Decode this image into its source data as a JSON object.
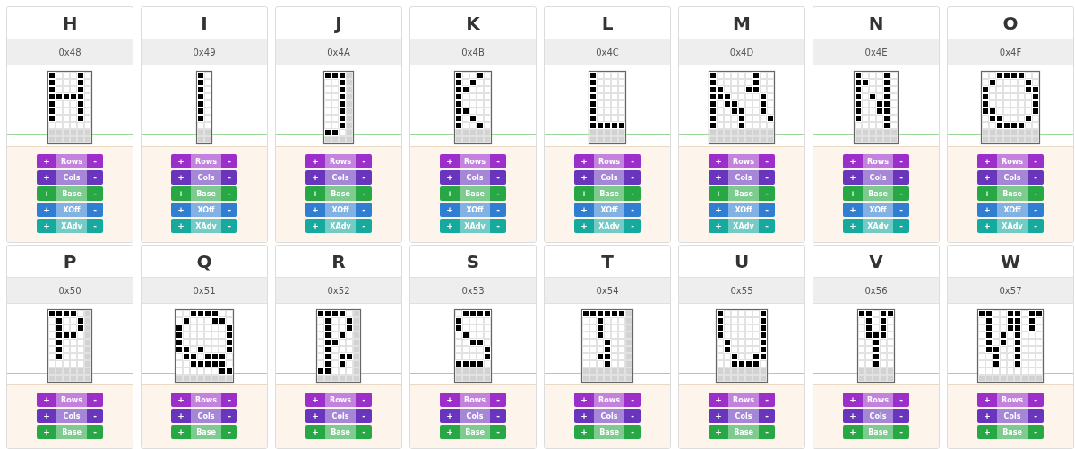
{
  "glyphs": [
    {
      "letter": "H",
      "code": "0x48",
      "pixels": [
        [
          true,
          false,
          false,
          false,
          true,
          false
        ],
        [
          true,
          false,
          false,
          false,
          true,
          false
        ],
        [
          true,
          false,
          false,
          false,
          true,
          false
        ],
        [
          true,
          true,
          true,
          true,
          true,
          false
        ],
        [
          true,
          false,
          false,
          false,
          true,
          false
        ],
        [
          true,
          false,
          false,
          false,
          true,
          false
        ],
        [
          true,
          false,
          false,
          false,
          true,
          false
        ],
        [
          false,
          false,
          false,
          false,
          false,
          false
        ]
      ],
      "margin_rows": [
        [
          false,
          false,
          false,
          false,
          false,
          false
        ],
        [
          false,
          false,
          false,
          false,
          false,
          false
        ]
      ],
      "controls": [
        {
          "label": "Rows",
          "plus": "+",
          "minus": "-",
          "color": "#9c2fc9"
        },
        {
          "label": "Cols",
          "plus": "+",
          "minus": "-",
          "color": "#6a35bd"
        },
        {
          "label": "Base",
          "plus": "+",
          "minus": "-",
          "color": "#27a844"
        },
        {
          "label": "XOff",
          "plus": "+",
          "minus": "-",
          "color": "#2f7ed1"
        },
        {
          "label": "XAdv",
          "plus": "+",
          "minus": "-",
          "color": "#16a99e"
        }
      ]
    },
    {
      "letter": "I",
      "code": "0x49",
      "pixels": [
        [
          true,
          false
        ],
        [
          true,
          false
        ],
        [
          true,
          false
        ],
        [
          true,
          false
        ],
        [
          true,
          false
        ],
        [
          true,
          false
        ],
        [
          true,
          false
        ],
        [
          false,
          false
        ]
      ],
      "margin_rows": [
        [
          false,
          false
        ],
        [
          false,
          false
        ]
      ],
      "controls": [
        {
          "label": "Rows",
          "plus": "+",
          "minus": "-",
          "color": "#9c2fc9"
        },
        {
          "label": "Cols",
          "plus": "+",
          "minus": "-",
          "color": "#6a35bd"
        },
        {
          "label": "Base",
          "plus": "+",
          "minus": "-",
          "color": "#27a844"
        },
        {
          "label": "XOff",
          "plus": "+",
          "minus": "-",
          "color": "#2f7ed1"
        },
        {
          "label": "XAdv",
          "plus": "+",
          "minus": "-",
          "color": "#16a99e"
        }
      ]
    },
    {
      "letter": "J",
      "code": "0x4A",
      "pixels": [
        [
          true,
          true,
          true
        ],
        [
          false,
          false,
          true
        ],
        [
          false,
          false,
          true
        ],
        [
          false,
          false,
          true
        ],
        [
          false,
          false,
          true
        ],
        [
          false,
          false,
          true
        ],
        [
          false,
          false,
          true
        ],
        [
          false,
          false,
          true
        ],
        [
          true,
          true,
          false
        ]
      ],
      "margin_column": true,
      "margin_rows": [
        [
          false,
          false,
          false,
          false
        ]
      ],
      "controls": [
        {
          "label": "Rows",
          "plus": "+",
          "minus": "-",
          "color": "#9c2fc9"
        },
        {
          "label": "Cols",
          "plus": "+",
          "minus": "-",
          "color": "#6a35bd"
        },
        {
          "label": "Base",
          "plus": "+",
          "minus": "-",
          "color": "#27a844"
        },
        {
          "label": "XOff",
          "plus": "+",
          "minus": "-",
          "color": "#2f7ed1"
        },
        {
          "label": "XAdv",
          "plus": "+",
          "minus": "-",
          "color": "#16a99e"
        }
      ]
    },
    {
      "letter": "K",
      "code": "0x4B",
      "pixels": [
        [
          true,
          false,
          false,
          true,
          false
        ],
        [
          true,
          false,
          true,
          false,
          false
        ],
        [
          true,
          true,
          false,
          false,
          false
        ],
        [
          true,
          false,
          false,
          false,
          false
        ],
        [
          true,
          false,
          false,
          false,
          false
        ],
        [
          true,
          true,
          false,
          false,
          false
        ],
        [
          true,
          false,
          true,
          false,
          false
        ],
        [
          true,
          false,
          false,
          true,
          false
        ]
      ],
      "margin_rows": [
        [
          false,
          false,
          false,
          false,
          false
        ],
        [
          false,
          false,
          false,
          false,
          false
        ]
      ],
      "controls": [
        {
          "label": "Rows",
          "plus": "+",
          "minus": "-",
          "color": "#9c2fc9"
        },
        {
          "label": "Cols",
          "plus": "+",
          "minus": "-",
          "color": "#6a35bd"
        },
        {
          "label": "Base",
          "plus": "+",
          "minus": "-",
          "color": "#27a844"
        },
        {
          "label": "XOff",
          "plus": "+",
          "minus": "-",
          "color": "#2f7ed1"
        },
        {
          "label": "XAdv",
          "plus": "+",
          "minus": "-",
          "color": "#16a99e"
        }
      ]
    },
    {
      "letter": "L",
      "code": "0x4C",
      "pixels": [
        [
          true,
          false,
          false,
          false,
          false
        ],
        [
          true,
          false,
          false,
          false,
          false
        ],
        [
          true,
          false,
          false,
          false,
          false
        ],
        [
          true,
          false,
          false,
          false,
          false
        ],
        [
          true,
          false,
          false,
          false,
          false
        ],
        [
          true,
          false,
          false,
          false,
          false
        ],
        [
          true,
          false,
          false,
          false,
          false
        ],
        [
          true,
          true,
          true,
          true,
          true
        ]
      ],
      "margin_rows": [
        [
          false,
          false,
          false,
          false,
          false
        ],
        [
          false,
          false,
          false,
          false,
          false
        ]
      ],
      "controls": [
        {
          "label": "Rows",
          "plus": "+",
          "minus": "-",
          "color": "#9c2fc9"
        },
        {
          "label": "Cols",
          "plus": "+",
          "minus": "-",
          "color": "#6a35bd"
        },
        {
          "label": "Base",
          "plus": "+",
          "minus": "-",
          "color": "#27a844"
        },
        {
          "label": "XOff",
          "plus": "+",
          "minus": "-",
          "color": "#2f7ed1"
        },
        {
          "label": "XAdv",
          "plus": "+",
          "minus": "-",
          "color": "#16a99e"
        }
      ]
    },
    {
      "letter": "M",
      "code": "0x4D",
      "pixels": [
        [
          true,
          false,
          false,
          false,
          false,
          false,
          true,
          false,
          false
        ],
        [
          true,
          false,
          false,
          false,
          false,
          false,
          true,
          false,
          false
        ],
        [
          true,
          true,
          false,
          false,
          false,
          true,
          true,
          false,
          false
        ],
        [
          true,
          true,
          true,
          false,
          false,
          false,
          false,
          true,
          false
        ],
        [
          true,
          false,
          true,
          true,
          false,
          false,
          false,
          true,
          false
        ],
        [
          true,
          false,
          false,
          true,
          true,
          false,
          false,
          true,
          false
        ],
        [
          true,
          false,
          false,
          false,
          true,
          false,
          false,
          false,
          true
        ],
        [
          true,
          false,
          false,
          false,
          true,
          false,
          false,
          false,
          false
        ]
      ],
      "margin_rows": [
        [
          false,
          false,
          false,
          false,
          false,
          false,
          false,
          false,
          false
        ],
        [
          false,
          false,
          false,
          false,
          false,
          false,
          false,
          false,
          false
        ]
      ],
      "controls": [
        {
          "label": "Rows",
          "plus": "+",
          "minus": "-",
          "color": "#9c2fc9"
        },
        {
          "label": "Cols",
          "plus": "+",
          "minus": "-",
          "color": "#6a35bd"
        },
        {
          "label": "Base",
          "plus": "+",
          "minus": "-",
          "color": "#27a844"
        },
        {
          "label": "XOff",
          "plus": "+",
          "minus": "-",
          "color": "#2f7ed1"
        },
        {
          "label": "XAdv",
          "plus": "+",
          "minus": "-",
          "color": "#16a99e"
        }
      ]
    },
    {
      "letter": "N",
      "code": "0x4E",
      "pixels": [
        [
          true,
          false,
          false,
          false,
          true,
          false
        ],
        [
          true,
          true,
          false,
          false,
          true,
          false
        ],
        [
          true,
          false,
          false,
          false,
          true,
          false
        ],
        [
          true,
          false,
          true,
          false,
          true,
          false
        ],
        [
          true,
          false,
          false,
          true,
          true,
          false
        ],
        [
          true,
          false,
          false,
          true,
          true,
          false
        ],
        [
          true,
          false,
          false,
          false,
          true,
          false
        ],
        [
          false,
          false,
          false,
          false,
          true,
          false
        ]
      ],
      "margin_rows": [
        [
          false,
          false,
          false,
          false,
          false,
          false
        ],
        [
          false,
          false,
          false,
          false,
          false,
          false
        ]
      ],
      "controls": [
        {
          "label": "Rows",
          "plus": "+",
          "minus": "-",
          "color": "#9c2fc9"
        },
        {
          "label": "Cols",
          "plus": "+",
          "minus": "-",
          "color": "#6a35bd"
        },
        {
          "label": "Base",
          "plus": "+",
          "minus": "-",
          "color": "#27a844"
        },
        {
          "label": "XOff",
          "plus": "+",
          "minus": "-",
          "color": "#2f7ed1"
        },
        {
          "label": "XAdv",
          "plus": "+",
          "minus": "-",
          "color": "#16a99e"
        }
      ]
    },
    {
      "letter": "O",
      "code": "0x4F",
      "pixels": [
        [
          false,
          false,
          true,
          true,
          true,
          true,
          false,
          false
        ],
        [
          false,
          true,
          false,
          false,
          false,
          false,
          true,
          false
        ],
        [
          true,
          false,
          false,
          false,
          false,
          false,
          true,
          true
        ],
        [
          true,
          false,
          false,
          false,
          false,
          false,
          false,
          true
        ],
        [
          true,
          false,
          false,
          false,
          false,
          false,
          false,
          true
        ],
        [
          true,
          true,
          false,
          false,
          false,
          false,
          false,
          true
        ],
        [
          false,
          true,
          true,
          false,
          false,
          false,
          true,
          false
        ],
        [
          false,
          false,
          true,
          true,
          true,
          true,
          false,
          false
        ]
      ],
      "margin_rows": [
        [
          false,
          false,
          false,
          false,
          false,
          false,
          false,
          false
        ],
        [
          false,
          false,
          false,
          false,
          false,
          false,
          false,
          false
        ]
      ],
      "controls": [
        {
          "label": "Rows",
          "plus": "+",
          "minus": "-",
          "color": "#9c2fc9"
        },
        {
          "label": "Cols",
          "plus": "+",
          "minus": "-",
          "color": "#6a35bd"
        },
        {
          "label": "Base",
          "plus": "+",
          "minus": "-",
          "color": "#27a844"
        },
        {
          "label": "XOff",
          "plus": "+",
          "minus": "-",
          "color": "#2f7ed1"
        },
        {
          "label": "XAdv",
          "plus": "+",
          "minus": "-",
          "color": "#16a99e"
        }
      ]
    },
    {
      "letter": "P",
      "code": "0x50",
      "pixels": [
        [
          true,
          true,
          true,
          true,
          false
        ],
        [
          false,
          true,
          false,
          false,
          true
        ],
        [
          false,
          true,
          false,
          false,
          true
        ],
        [
          false,
          true,
          true,
          true,
          false
        ],
        [
          false,
          true,
          false,
          false,
          false
        ],
        [
          false,
          true,
          false,
          false,
          false
        ],
        [
          false,
          true,
          false,
          false,
          false
        ],
        [
          false,
          false,
          false,
          false,
          false
        ]
      ],
      "margin_column": true,
      "margin_rows": [
        [
          false,
          false,
          false,
          false,
          false,
          false
        ],
        [
          false,
          false,
          false,
          false,
          false,
          false
        ]
      ],
      "controls": [
        {
          "label": "Rows",
          "plus": "+",
          "minus": "-",
          "color": "#9c2fc9"
        },
        {
          "label": "Cols",
          "plus": "+",
          "minus": "-",
          "color": "#6a35bd"
        },
        {
          "label": "Base",
          "plus": "+",
          "minus": "-",
          "color": "#27a844"
        }
      ]
    },
    {
      "letter": "Q",
      "code": "0x51",
      "pixels": [
        [
          false,
          false,
          true,
          true,
          true,
          true,
          false,
          false
        ],
        [
          false,
          true,
          false,
          false,
          false,
          true,
          true,
          false
        ],
        [
          true,
          false,
          false,
          false,
          false,
          false,
          false,
          true
        ],
        [
          true,
          false,
          false,
          false,
          false,
          false,
          false,
          true
        ],
        [
          true,
          false,
          false,
          false,
          false,
          false,
          false,
          true
        ],
        [
          true,
          true,
          false,
          true,
          false,
          false,
          false,
          true
        ],
        [
          false,
          true,
          true,
          false,
          true,
          true,
          true,
          false
        ],
        [
          false,
          false,
          true,
          true,
          true,
          true,
          true,
          false
        ],
        [
          false,
          false,
          false,
          false,
          false,
          false,
          true,
          true
        ]
      ],
      "margin_rows": [
        [
          false,
          false,
          false,
          false,
          false,
          false,
          false,
          false
        ]
      ],
      "controls": [
        {
          "label": "Rows",
          "plus": "+",
          "minus": "-",
          "color": "#9c2fc9"
        },
        {
          "label": "Cols",
          "plus": "+",
          "minus": "-",
          "color": "#6a35bd"
        },
        {
          "label": "Base",
          "plus": "+",
          "minus": "-",
          "color": "#27a844"
        }
      ]
    },
    {
      "letter": "R",
      "code": "0x52",
      "pixels": [
        [
          true,
          true,
          true,
          true,
          false
        ],
        [
          false,
          true,
          false,
          false,
          true
        ],
        [
          false,
          true,
          false,
          false,
          true
        ],
        [
          false,
          true,
          false,
          true,
          false
        ],
        [
          false,
          true,
          true,
          false,
          false
        ],
        [
          false,
          true,
          false,
          false,
          false
        ],
        [
          false,
          true,
          false,
          true,
          true
        ],
        [
          false,
          true,
          false,
          true,
          false
        ],
        [
          true,
          true,
          false,
          false,
          false
        ]
      ],
      "margin_column": true,
      "margin_rows": [
        [
          false,
          false,
          false,
          false,
          false,
          false
        ]
      ],
      "controls": [
        {
          "label": "Rows",
          "plus": "+",
          "minus": "-",
          "color": "#9c2fc9"
        },
        {
          "label": "Cols",
          "plus": "+",
          "minus": "-",
          "color": "#6a35bd"
        },
        {
          "label": "Base",
          "plus": "+",
          "minus": "-",
          "color": "#27a844"
        }
      ]
    },
    {
      "letter": "S",
      "code": "0x53",
      "pixels": [
        [
          false,
          true,
          true,
          true,
          true
        ],
        [
          true,
          false,
          false,
          false,
          false
        ],
        [
          true,
          false,
          false,
          false,
          false
        ],
        [
          false,
          true,
          false,
          false,
          false
        ],
        [
          false,
          false,
          true,
          true,
          false
        ],
        [
          false,
          false,
          false,
          false,
          true
        ],
        [
          false,
          false,
          false,
          false,
          true
        ],
        [
          true,
          true,
          true,
          true,
          false
        ]
      ],
      "margin_rows": [
        [
          false,
          false,
          false,
          false,
          false
        ],
        [
          false,
          false,
          false,
          false,
          false
        ]
      ],
      "controls": [
        {
          "label": "Rows",
          "plus": "+",
          "minus": "-",
          "color": "#9c2fc9"
        },
        {
          "label": "Cols",
          "plus": "+",
          "minus": "-",
          "color": "#6a35bd"
        },
        {
          "label": "Base",
          "plus": "+",
          "minus": "-",
          "color": "#27a844"
        }
      ]
    },
    {
      "letter": "T",
      "code": "0x54",
      "pixels": [
        [
          true,
          true,
          true,
          true,
          true,
          true
        ],
        [
          false,
          false,
          true,
          false,
          false,
          false
        ],
        [
          false,
          false,
          true,
          false,
          false,
          false
        ],
        [
          false,
          false,
          true,
          false,
          false,
          false
        ],
        [
          false,
          false,
          false,
          true,
          false,
          false
        ],
        [
          false,
          false,
          false,
          true,
          false,
          false
        ],
        [
          false,
          false,
          true,
          true,
          false,
          false
        ],
        [
          false,
          false,
          false,
          true,
          false,
          false
        ]
      ],
      "margin_column": true,
      "margin_rows": [
        [
          false,
          false,
          false,
          false,
          false,
          false,
          false
        ],
        [
          false,
          false,
          false,
          false,
          false,
          false,
          false
        ]
      ],
      "controls": [
        {
          "label": "Rows",
          "plus": "+",
          "minus": "-",
          "color": "#9c2fc9"
        },
        {
          "label": "Cols",
          "plus": "+",
          "minus": "-",
          "color": "#6a35bd"
        },
        {
          "label": "Base",
          "plus": "+",
          "minus": "-",
          "color": "#27a844"
        }
      ]
    },
    {
      "letter": "U",
      "code": "0x55",
      "pixels": [
        [
          true,
          false,
          false,
          false,
          false,
          false,
          true
        ],
        [
          true,
          false,
          false,
          false,
          false,
          false,
          true
        ],
        [
          true,
          false,
          false,
          false,
          false,
          false,
          true
        ],
        [
          true,
          false,
          false,
          false,
          false,
          false,
          true
        ],
        [
          false,
          true,
          false,
          false,
          false,
          false,
          true
        ],
        [
          false,
          true,
          false,
          false,
          false,
          false,
          true
        ],
        [
          false,
          false,
          true,
          false,
          false,
          true,
          true
        ],
        [
          false,
          false,
          true,
          true,
          true,
          true,
          false
        ]
      ],
      "margin_rows": [
        [
          false,
          false,
          false,
          false,
          false,
          false,
          false
        ],
        [
          false,
          false,
          false,
          false,
          false,
          false,
          false
        ]
      ],
      "controls": [
        {
          "label": "Rows",
          "plus": "+",
          "minus": "-",
          "color": "#9c2fc9"
        },
        {
          "label": "Cols",
          "plus": "+",
          "minus": "-",
          "color": "#6a35bd"
        },
        {
          "label": "Base",
          "plus": "+",
          "minus": "-",
          "color": "#27a844"
        }
      ]
    },
    {
      "letter": "V",
      "code": "0x56",
      "pixels": [
        [
          true,
          true,
          false,
          true,
          true
        ],
        [
          false,
          true,
          false,
          true,
          false
        ],
        [
          false,
          true,
          false,
          true,
          false
        ],
        [
          false,
          true,
          true,
          true,
          false
        ],
        [
          false,
          false,
          true,
          false,
          false
        ],
        [
          false,
          false,
          true,
          false,
          false
        ],
        [
          false,
          false,
          true,
          false,
          false
        ],
        [
          false,
          false,
          true,
          false,
          false
        ]
      ],
      "margin_rows": [
        [
          false,
          false,
          false,
          false,
          false
        ],
        [
          false,
          false,
          false,
          false,
          false
        ]
      ],
      "controls": [
        {
          "label": "Rows",
          "plus": "+",
          "minus": "-",
          "color": "#9c2fc9"
        },
        {
          "label": "Cols",
          "plus": "+",
          "minus": "-",
          "color": "#6a35bd"
        },
        {
          "label": "Base",
          "plus": "+",
          "minus": "-",
          "color": "#27a844"
        }
      ]
    },
    {
      "letter": "W",
      "code": "0x57",
      "pixels": [
        [
          true,
          true,
          false,
          false,
          true,
          true,
          false,
          true,
          true
        ],
        [
          false,
          true,
          false,
          false,
          true,
          true,
          false,
          true,
          false
        ],
        [
          false,
          true,
          false,
          false,
          true,
          true,
          false,
          true,
          false
        ],
        [
          false,
          true,
          false,
          true,
          false,
          true,
          false,
          false,
          false
        ],
        [
          false,
          true,
          false,
          true,
          false,
          true,
          false,
          false,
          false
        ],
        [
          false,
          true,
          true,
          false,
          false,
          true,
          false,
          false,
          false
        ],
        [
          false,
          false,
          true,
          false,
          false,
          true,
          false,
          false,
          false
        ],
        [
          false,
          false,
          true,
          false,
          false,
          true,
          false,
          false,
          false
        ],
        [
          false,
          false,
          false,
          false,
          false,
          false,
          false,
          false,
          false
        ]
      ],
      "margin_rows": [
        [
          false,
          false,
          false,
          false,
          false,
          false,
          false,
          false,
          false
        ]
      ],
      "controls": [
        {
          "label": "Rows",
          "plus": "+",
          "minus": "-",
          "color": "#9c2fc9"
        },
        {
          "label": "Cols",
          "plus": "+",
          "minus": "-",
          "color": "#6a35bd"
        },
        {
          "label": "Base",
          "plus": "+",
          "minus": "-",
          "color": "#27a844"
        }
      ]
    }
  ]
}
